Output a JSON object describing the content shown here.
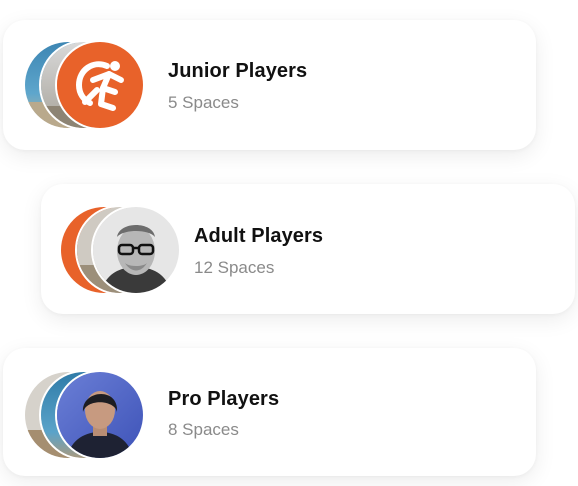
{
  "groups": [
    {
      "title": "Junior Players",
      "subtitle": "5 Spaces"
    },
    {
      "title": "Adult Players",
      "subtitle": "12 Spaces"
    },
    {
      "title": "Pro Players",
      "subtitle": "8 Spaces"
    }
  ],
  "icons": {
    "brand_logo": "running-figure-logo-icon",
    "avatar_photo": "avatar-image"
  },
  "colors": {
    "brand_orange": "#E8622A",
    "title": "#111111",
    "subtitle": "#8A8A8A",
    "card_bg": "#FFFFFF"
  }
}
